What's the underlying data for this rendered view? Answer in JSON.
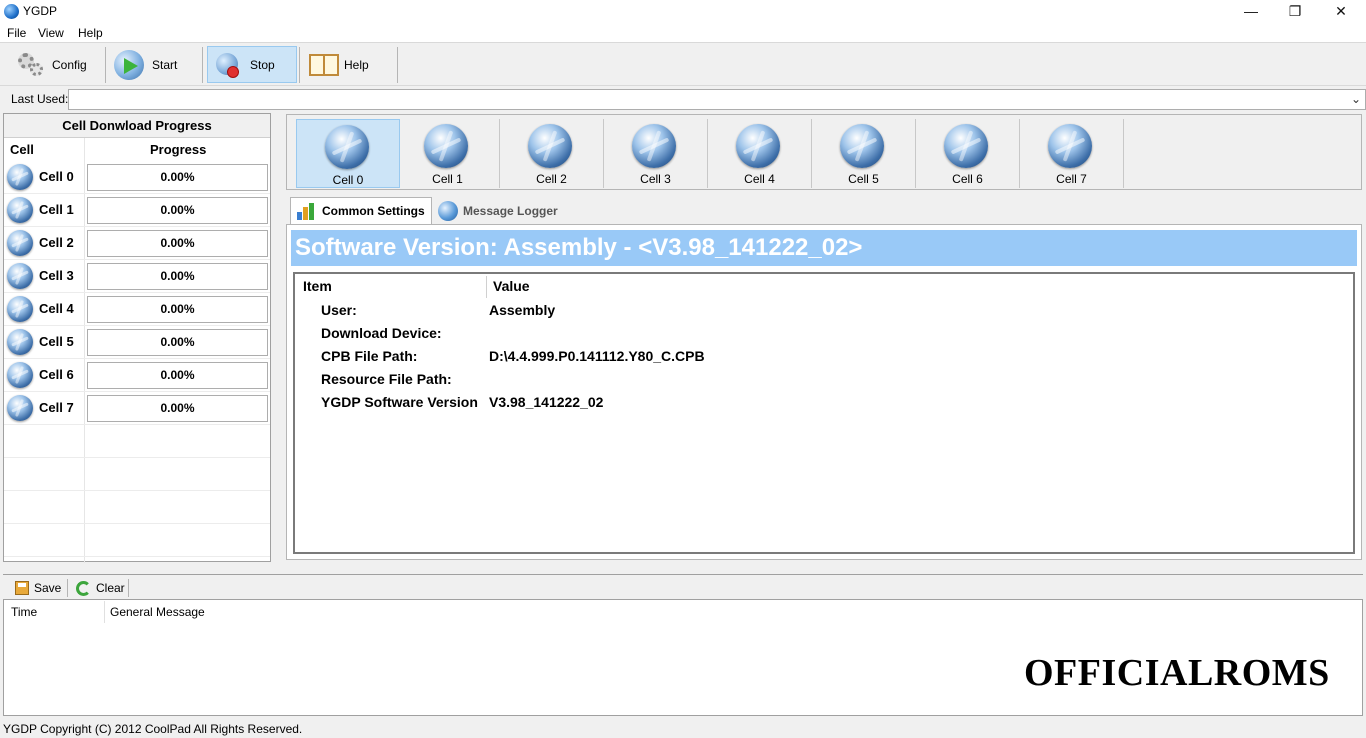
{
  "window": {
    "title": "YGDP",
    "controls": [
      "—",
      "❐",
      "✕"
    ]
  },
  "menu": [
    "File",
    "View",
    "Help"
  ],
  "toolbar": {
    "config_label": "Config",
    "start_label": "Start",
    "stop_label": "Stop",
    "help_label": "Help"
  },
  "last_used": {
    "label": "Last Used:",
    "value": ""
  },
  "left_panel": {
    "title": "Cell Donwload Progress",
    "col_cell": "Cell",
    "col_progress": "Progress",
    "rows": [
      {
        "name": "Cell 0",
        "progress": "0.00%"
      },
      {
        "name": "Cell 1",
        "progress": "0.00%"
      },
      {
        "name": "Cell 2",
        "progress": "0.00%"
      },
      {
        "name": "Cell 3",
        "progress": "0.00%"
      },
      {
        "name": "Cell 4",
        "progress": "0.00%"
      },
      {
        "name": "Cell 5",
        "progress": "0.00%"
      },
      {
        "name": "Cell 6",
        "progress": "0.00%"
      },
      {
        "name": "Cell 7",
        "progress": "0.00%"
      }
    ]
  },
  "cell_tiles": [
    "Cell 0",
    "Cell 1",
    "Cell 2",
    "Cell 3",
    "Cell 4",
    "Cell 5",
    "Cell 6",
    "Cell 7"
  ],
  "selected_cell": "Cell 0",
  "tabs": [
    {
      "label": "Common Settings",
      "selected": true
    },
    {
      "label": "Message Logger",
      "selected": false
    }
  ],
  "version_banner": "Software Version:  Assembly - <V3.98_141222_02>",
  "properties": {
    "col_item": "Item",
    "col_value": "Value",
    "rows": [
      {
        "key": "User:",
        "value": "Assembly"
      },
      {
        "key": "Download Device:",
        "value": ""
      },
      {
        "key": "CPB File Path:",
        "value": "D:\\4.4.999.P0.141112.Y80_C.CPB"
      },
      {
        "key": "Resource File Path:",
        "value": ""
      },
      {
        "key": "YGDP Software Version",
        "value": "V3.98_141222_02"
      }
    ]
  },
  "log": {
    "save_label": "Save",
    "clear_label": "Clear",
    "col_time": "Time",
    "col_message": "General Message"
  },
  "watermark": "OFFICIALROMS",
  "status": "YGDP Copyright (C) 2012 CoolPad All Rights Reserved.",
  "colors": {
    "selection": "#cce4f7",
    "banner": "#99c9f7"
  }
}
